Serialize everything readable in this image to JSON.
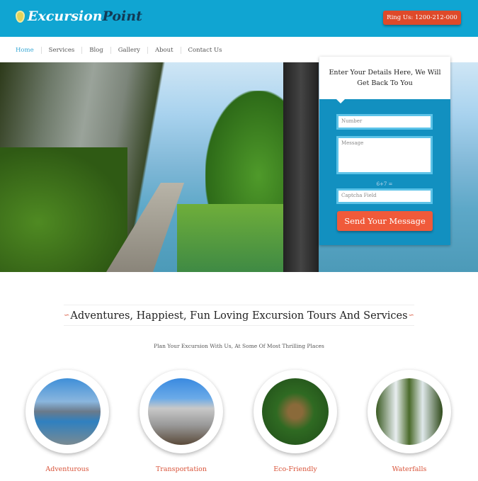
{
  "header": {
    "logo_a": "Excursion",
    "logo_b": "Point",
    "phone_button": "Ring Us: 1200-212-000"
  },
  "nav": [
    "Home",
    "Services",
    "Blog",
    "Gallery",
    "About",
    "Contact Us"
  ],
  "form": {
    "title": "Enter Your Details Here, We Will Get Back To You",
    "number_placeholder": "Number",
    "message_placeholder": "Message",
    "captcha_question": "6+7 =",
    "captcha_placeholder": "Captcha Field",
    "submit": "Send Your Message"
  },
  "section": {
    "heading": "Adventures, Happiest, Fun Loving Excursion Tours And Services",
    "subheading": "Plan Your Excursion With Us, At Some Of Most Thrilling Places"
  },
  "features": [
    {
      "label": "Adventurous"
    },
    {
      "label": "Transportation"
    },
    {
      "label": "Eco-Friendly"
    },
    {
      "label": "Waterfalls"
    }
  ],
  "colors": {
    "brand": "#10a5d2",
    "accent": "#f05a3a"
  }
}
